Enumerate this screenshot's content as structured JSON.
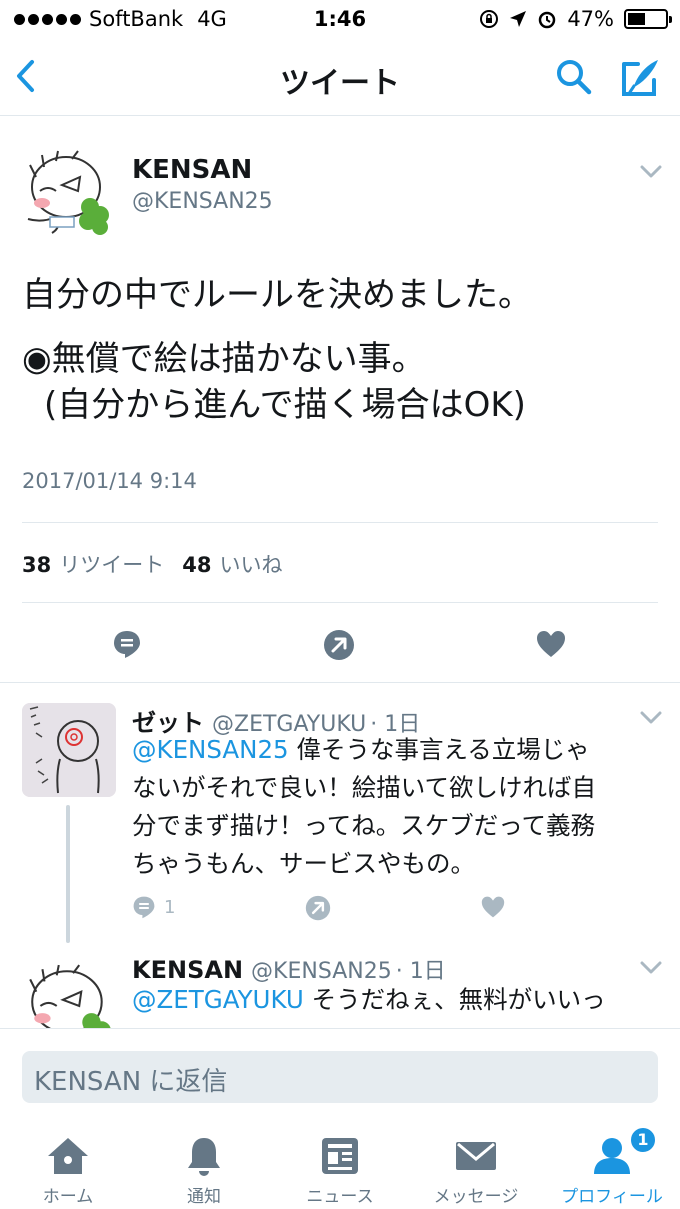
{
  "status_bar": {
    "carrier": "SoftBank",
    "network": "4G",
    "time": "1:46",
    "battery_percent": "47%",
    "battery_level": 0.47
  },
  "nav": {
    "title": "ツイート",
    "back_icon": "chevron-left-icon",
    "search_icon": "search-icon",
    "compose_icon": "compose-icon"
  },
  "tweet": {
    "author_name": "KENSAN",
    "author_handle": "@KENSAN25",
    "text_lines": [
      "自分の中でルールを決めました。",
      "◉無償で絵は描かない事。",
      "(自分から進んで描く場合はOK)"
    ],
    "date": "2017/01/14 9:14",
    "retweet_count": "38",
    "retweet_label": "リツイート",
    "like_count": "48",
    "like_label": "いいね"
  },
  "replies": [
    {
      "name": "ゼット",
      "handle": "@ZETGAYUKU",
      "time": "· 1日",
      "mention": "@KENSAN25",
      "lines": [
        " 偉そうな事言える立場じゃ",
        "ないがそれで良い！絵描いて欲しければ自",
        "分でまず描け！ってね。スケブだって義務",
        "ちゃうもん、サービスやもの。"
      ],
      "reply_count": "1"
    },
    {
      "name": "KENSAN",
      "handle": "@KENSAN25",
      "time": "· 1日",
      "mention": "@ZETGAYUKU",
      "lines": [
        " そうだねぇ、無料がいいっ"
      ]
    }
  ],
  "reply_box": {
    "placeholder": "KENSAN に返信"
  },
  "tabs": [
    {
      "label": "ホーム",
      "icon": "home-icon"
    },
    {
      "label": "通知",
      "icon": "bell-icon"
    },
    {
      "label": "ニュース",
      "icon": "news-icon"
    },
    {
      "label": "メッセージ",
      "icon": "envelope-icon"
    },
    {
      "label": "プロフィール",
      "icon": "profile-icon",
      "badge": "1",
      "active": true
    }
  ],
  "colors": {
    "accent": "#1b95e0",
    "muted": "#657786",
    "icon_gray": "#657786",
    "divider": "#e1e8ed"
  }
}
